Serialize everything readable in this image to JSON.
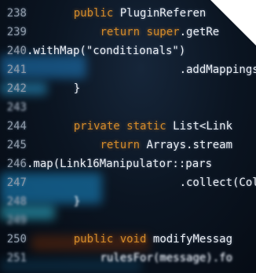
{
  "code_lines": [
    {
      "num": "238",
      "indent": "    ",
      "parts": [
        {
          "t": "public ",
          "k": "kw"
        },
        {
          "t": "PluginReferen",
          "k": "txt"
        }
      ]
    },
    {
      "num": "239",
      "indent": "        ",
      "parts": [
        {
          "t": "return ",
          "k": "kw"
        },
        {
          "t": "super",
          "k": "kw"
        },
        {
          "t": ".getRe",
          "k": "txt"
        }
      ]
    },
    {
      "num": "240",
      "indent": "",
      "parts": [
        {
          "t": ".withMap(\"conditionals\")",
          "k": "txt"
        }
      ]
    },
    {
      "num": "241",
      "indent": "                    ",
      "parts": [
        {
          "t": ".addMappings",
          "k": "txt"
        }
      ]
    },
    {
      "num": "242",
      "indent": "    ",
      "parts": [
        {
          "t": "}",
          "k": "txt"
        }
      ]
    },
    {
      "num": "243",
      "indent": "",
      "parts": []
    },
    {
      "num": "244",
      "indent": "    ",
      "parts": [
        {
          "t": "private ",
          "k": "kw"
        },
        {
          "t": "static ",
          "k": "kw"
        },
        {
          "t": "List<Link",
          "k": "txt"
        }
      ]
    },
    {
      "num": "245",
      "indent": "        ",
      "parts": [
        {
          "t": "return ",
          "k": "kw"
        },
        {
          "t": "Arrays.stream",
          "k": "txt"
        }
      ]
    },
    {
      "num": "246",
      "indent": "",
      "parts": [
        {
          "t": ".map(Link16Manipulator::pars",
          "k": "txt"
        }
      ]
    },
    {
      "num": "247",
      "indent": "                    ",
      "parts": [
        {
          "t": ".collect(Col",
          "k": "txt"
        }
      ]
    },
    {
      "num": "248",
      "indent": "    ",
      "parts": [
        {
          "t": "}",
          "k": "txt"
        }
      ]
    },
    {
      "num": "249",
      "indent": "",
      "parts": []
    },
    {
      "num": "250",
      "indent": "    ",
      "parts": [
        {
          "t": "public ",
          "k": "kw"
        },
        {
          "t": "void ",
          "k": "kw"
        },
        {
          "t": "modifyMessag",
          "k": "txt"
        }
      ]
    },
    {
      "num": "251",
      "indent": "        ",
      "parts": [
        {
          "t": "rulesFor(message).fo",
          "k": "txt"
        }
      ]
    }
  ]
}
